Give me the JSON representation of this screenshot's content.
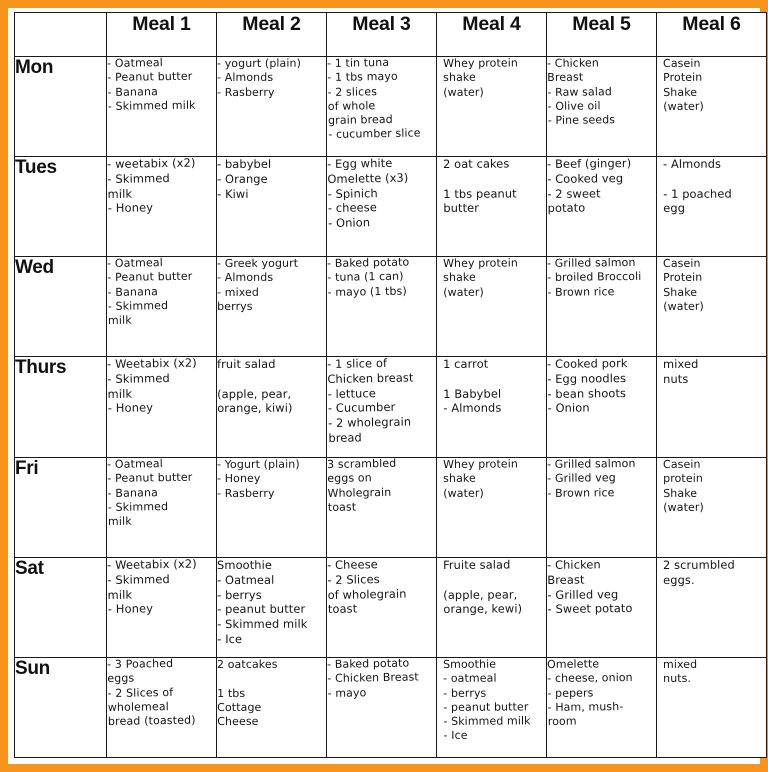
{
  "document": {
    "type": "handwritten-weekly-meal-plan-table",
    "border_color": "#f7941e",
    "grid_color": "#1a1a1a",
    "paper_color": "#ffffff",
    "ink_color": "#141414"
  },
  "table": {
    "corner_label": "",
    "column_headers": [
      "Meal 1",
      "Meal 2",
      "Meal 3",
      "Meal 4",
      "Meal 5",
      "Meal 6"
    ],
    "row_headers": [
      "Mon",
      "Tues",
      "Wed",
      "Thurs",
      "Fri",
      "Sat",
      "Sun"
    ],
    "rows": [
      {
        "day": "Mon",
        "meals": [
          "- Oatmeal\n- Peanut butter\n- Banana\n- Skimmed milk",
          "- yogurt (plain)\n- Almonds\n- Rasberry",
          "- 1 tin tuna\n- 1 tbs mayo\n- 2 slices\n  of whole\n  grain bread\n- cucumber slice",
          "Whey protein\nshake\n(water)",
          "- Chicken\n  Breast\n- Raw salad\n- Olive oil\n- Pine seeds",
          "Casein\nProtein\nShake\n(water)"
        ]
      },
      {
        "day": "Tues",
        "meals": [
          "- weetabix (x2)\n- Skimmed\n   milk\n- Honey",
          "- babybel\n- Orange\n- Kiwi",
          "- Egg white\n  Omelette (x3)\n- Spinich\n- cheese\n- Onion",
          "2 oat cakes\n\n1 tbs peanut\n     butter",
          "- Beef (ginger)\n- Cooked veg\n- 2 sweet\n   potato",
          "- Almonds\n\n- 1 poached\n   egg"
        ]
      },
      {
        "day": "Wed",
        "meals": [
          "- Oatmeal\n- Peanut butter\n- Banana\n- Skimmed\n   milk",
          "- Greek yogurt\n- Almonds\n- mixed\n   berrys",
          "- Baked potato\n- tuna (1 can)\n- mayo (1 tbs)",
          "Whey protein\nshake\n(water)",
          "- Grilled salmon\n- broiled Broccoli\n- Brown rice",
          "Casein\nProtein\nShake\n(water)"
        ]
      },
      {
        "day": "Thurs",
        "meals": [
          "- Weetabix (x2)\n- Skimmed\n   milk\n- Honey",
          "fruit salad\n\n(apple, pear,\n orange, kiwi)",
          "- 1 slice of\n  Chicken breast\n- lettuce\n- Cucumber\n- 2 wholegrain\n   bread",
          "1 carrot\n\n1 Babybel\n- Almonds",
          "- Cooked pork\n- Egg noodles\n- bean shoots\n- Onion",
          "mixed\n nuts"
        ]
      },
      {
        "day": "Fri",
        "meals": [
          "- Oatmeal\n- Peanut butter\n- Banana\n- Skimmed\n   milk",
          "- Yogurt (plain)\n- Honey\n- Rasberry",
          "3 scrambled\neggs on\nWholegrain\ntoast",
          "Whey protein\nshake\n(water)",
          "- Grilled salmon\n- Grilled veg\n- Brown rice",
          "Casein\nprotein\nShake\n(water)"
        ]
      },
      {
        "day": "Sat",
        "meals": [
          "- Weetabix (x2)\n- Skimmed\n   milk\n- Honey",
          "Smoothie\n- Oatmeal\n- berrys\n- peanut butter\n- Skimmed milk\n- Ice",
          "- Cheese\n- 2 Slices\n  of wholegrain\n  toast",
          "Fruite salad\n\n(apple, pear,\n orange, kewi)",
          "- Chicken\n  Breast\n- Grilled veg\n- Sweet potato",
          "2 scrumbled\n   eggs."
        ]
      },
      {
        "day": "Sun",
        "meals": [
          "- 3 Poached\n  eggs\n- 2 Slices of\n   wholemeal\n   bread (toasted)",
          "2 oatcakes\n\n1 tbs\nCottage\nCheese",
          "- Baked potato\n- Chicken Breast\n- mayo",
          "Smoothie\n- oatmeal\n- berrys\n- peanut butter\n- Skimmed milk\n- Ice",
          "Omelette\n- cheese, onion\n- pepers\n- Ham, mush-\n  room",
          "mixed\nnuts."
        ]
      }
    ]
  }
}
